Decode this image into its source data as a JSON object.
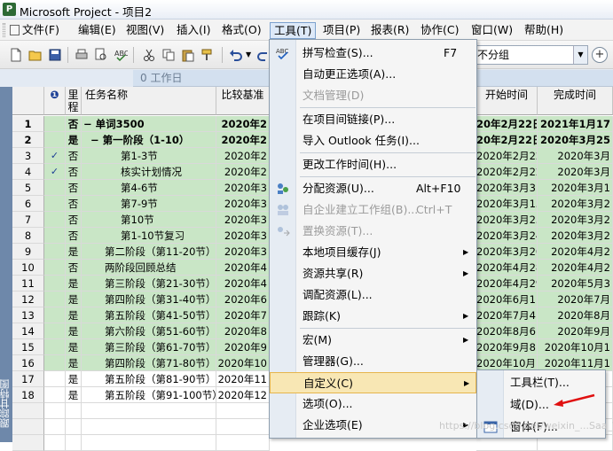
{
  "window": {
    "title": "Microsoft Project - 项目2"
  },
  "menubar": {
    "items": [
      {
        "label": "文件(F)",
        "left": 0
      },
      {
        "label": "编辑(E)"
      },
      {
        "label": "视图(V)"
      },
      {
        "label": "插入(I)"
      },
      {
        "label": "格式(O)"
      },
      {
        "label": "工具(T)"
      },
      {
        "label": "项目(P)"
      },
      {
        "label": "报表(R)"
      },
      {
        "label": "协作(C)"
      },
      {
        "label": "窗口(W)"
      },
      {
        "label": "帮助(H)"
      }
    ]
  },
  "toolbar": {
    "group_value": "不分组"
  },
  "entrybar": {
    "value": "0 工作日"
  },
  "viewbar": {
    "label": "跟踪甘特图"
  },
  "grid": {
    "headers": {
      "id": "",
      "indicator": "❶",
      "milestone": "里程",
      "name": "任务名称",
      "baseline": "比较基准",
      "start": "开始时间",
      "finish": "完成时间"
    },
    "rows": [
      {
        "id": "1",
        "check": "",
        "ms": "否",
        "name": "− 单词3500",
        "base": "2020年2",
        "start": "20年2月22日",
        "finish": "2021年1月17",
        "type": "summary",
        "indent": 0
      },
      {
        "id": "2",
        "check": "",
        "ms": "是",
        "name": "− 第一阶段（1-10）",
        "base": "2020年2",
        "start": "20年2月22日",
        "finish": "2020年3月25",
        "type": "summary",
        "indent": 1
      },
      {
        "id": "3",
        "check": "✓",
        "ms": "否",
        "name": "第1-3节",
        "base": "2020年2",
        "start": "2020年2月22日",
        "finish": "2020年3月",
        "type": "task",
        "indent": 3
      },
      {
        "id": "4",
        "check": "✓",
        "ms": "否",
        "name": "核实计划情况",
        "base": "2020年2",
        "start": "2020年2月22日",
        "finish": "2020年3月",
        "type": "task",
        "indent": 3
      },
      {
        "id": "5",
        "check": "",
        "ms": "否",
        "name": "第4-6节",
        "base": "2020年3",
        "start": "2020年3月3日",
        "finish": "2020年3月1",
        "type": "task",
        "indent": 3
      },
      {
        "id": "6",
        "check": "",
        "ms": "否",
        "name": "第7-9节",
        "base": "2020年3",
        "start": "2020年3月13日",
        "finish": "2020年3月2",
        "type": "task",
        "indent": 3
      },
      {
        "id": "7",
        "check": "",
        "ms": "否",
        "name": "第10节",
        "base": "2020年3",
        "start": "2020年3月23日",
        "finish": "2020年3月2",
        "type": "task",
        "indent": 3
      },
      {
        "id": "8",
        "check": "",
        "ms": "否",
        "name": "第1-10节复习",
        "base": "2020年3",
        "start": "2020年3月24日",
        "finish": "2020年3月2",
        "type": "task",
        "indent": 3
      },
      {
        "id": "9",
        "check": "",
        "ms": "是",
        "name": "第二阶段（第11-20节）",
        "base": "2020年3",
        "start": "2020年3月26日",
        "finish": "2020年4月2",
        "type": "task",
        "indent": 2
      },
      {
        "id": "10",
        "check": "",
        "ms": "否",
        "name": "两阶段回顾总结",
        "base": "2020年4",
        "start": "2020年4月28日",
        "finish": "2020年4月2",
        "type": "task",
        "indent": 2
      },
      {
        "id": "11",
        "check": "",
        "ms": "是",
        "name": "第三阶段（第21-30节）",
        "base": "2020年4",
        "start": "2020年4月29日",
        "finish": "2020年5月3",
        "type": "task",
        "indent": 2
      },
      {
        "id": "12",
        "check": "",
        "ms": "是",
        "name": "第四阶段（第31-40节）",
        "base": "2020年6",
        "start": "2020年6月1日",
        "finish": "2020年7月",
        "type": "task",
        "indent": 2
      },
      {
        "id": "13",
        "check": "",
        "ms": "是",
        "name": "第五阶段（第41-50节）",
        "base": "2020年7",
        "start": "2020年7月4日",
        "finish": "2020年8月",
        "type": "task",
        "indent": 2
      },
      {
        "id": "14",
        "check": "",
        "ms": "是",
        "name": "第六阶段（第51-60节）",
        "base": "2020年8",
        "start": "2020年8月6日",
        "finish": "2020年9月",
        "type": "task",
        "indent": 2
      },
      {
        "id": "15",
        "check": "",
        "ms": "是",
        "name": "第三阶段（第61-70节）",
        "base": "2020年9",
        "start": "2020年9月8日",
        "finish": "2020年10月1",
        "type": "task",
        "indent": 2
      },
      {
        "id": "16",
        "check": "",
        "ms": "是",
        "name": "第四阶段（第71-80节）",
        "base": "2020年10",
        "start": "2020年10月11日",
        "finish": "2020年11月1",
        "type": "task",
        "indent": 2
      },
      {
        "id": "17",
        "check": "",
        "ms": "是",
        "name": "第五阶段（第81-90节）",
        "base": "2020年11",
        "start": "",
        "finish": "",
        "type": "task",
        "indent": 2
      },
      {
        "id": "18",
        "check": "",
        "ms": "是",
        "name": "第五阶段（第91-100节）",
        "base": "2020年12",
        "start": "",
        "finish": "",
        "type": "task",
        "indent": 2
      }
    ]
  },
  "tools_menu": {
    "items": [
      {
        "label": "拼写检查(S)...",
        "shortcut": "F7",
        "icon": "spellcheck-icon"
      },
      {
        "label": "自动更正选项(A)..."
      },
      {
        "label": "文档管理(D)",
        "disabled": true
      },
      {
        "sep": true
      },
      {
        "label": "在项目间链接(P)..."
      },
      {
        "label": "导入 Outlook 任务(I)..."
      },
      {
        "sep": true
      },
      {
        "label": "更改工作时间(H)..."
      },
      {
        "sep": true
      },
      {
        "label": "分配资源(U)...",
        "shortcut": "Alt+F10",
        "icon": "assign-resources-icon"
      },
      {
        "label": "自企业建立工作组(B)...",
        "shortcut": "Ctrl+T",
        "disabled": true,
        "icon": "team-icon"
      },
      {
        "label": "置换资源(T)...",
        "disabled": true,
        "icon": "substitute-resources-icon"
      },
      {
        "label": "本地项目缓存(J)",
        "submenu": true
      },
      {
        "label": "资源共享(R)",
        "submenu": true
      },
      {
        "label": "调配资源(L)..."
      },
      {
        "label": "跟踪(K)",
        "submenu": true
      },
      {
        "sep": true
      },
      {
        "label": "宏(M)",
        "submenu": true
      },
      {
        "label": "管理器(G)..."
      },
      {
        "label": "自定义(C)",
        "submenu": true,
        "highlight": true
      },
      {
        "label": "选项(O)..."
      },
      {
        "label": "企业选项(E)",
        "submenu": true
      }
    ]
  },
  "customize_submenu": {
    "items": [
      {
        "label": "工具栏(T)..."
      },
      {
        "label": "域(D)..."
      },
      {
        "label": "窗体(F)...",
        "icon": "form-icon"
      }
    ]
  },
  "watermark": "https://blog.csdn.net/weixin_...Saa_W"
}
